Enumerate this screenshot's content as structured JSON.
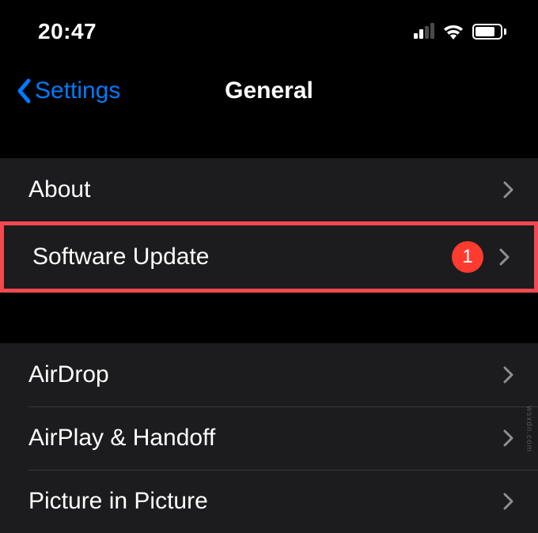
{
  "status_bar": {
    "time": "20:47"
  },
  "nav": {
    "back_label": "Settings",
    "title": "General"
  },
  "group1": {
    "items": [
      {
        "label": "About"
      },
      {
        "label": "Software Update",
        "badge": "1",
        "highlighted": true
      }
    ]
  },
  "group2": {
    "items": [
      {
        "label": "AirDrop"
      },
      {
        "label": "AirPlay & Handoff"
      },
      {
        "label": "Picture in Picture"
      }
    ]
  },
  "watermark": "wsxdn.com"
}
